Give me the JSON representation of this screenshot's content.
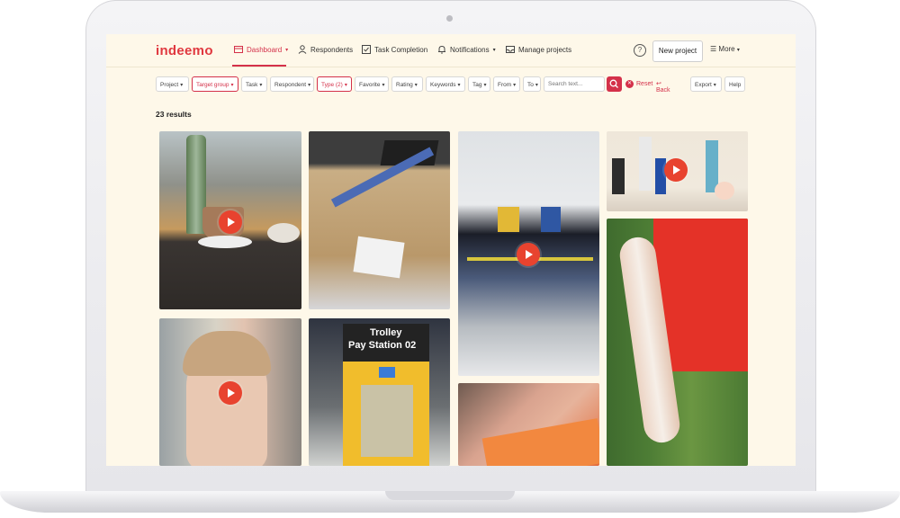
{
  "app": {
    "logo": "indeemo"
  },
  "nav": {
    "items": [
      {
        "label": "Dashboard",
        "icon": "dashboard-icon",
        "active": true
      },
      {
        "label": "Respondents",
        "icon": "user-icon"
      },
      {
        "label": "Task Completion",
        "icon": "checkbox-icon"
      },
      {
        "label": "Notifications",
        "icon": "bell-icon"
      },
      {
        "label": "Manage projects",
        "icon": "inbox-icon"
      }
    ],
    "help_icon": "question-circle-icon",
    "new_project_label": "New project",
    "more_label": "More"
  },
  "filters": {
    "chips": [
      {
        "label": "Project",
        "selected": false
      },
      {
        "label": "Target group",
        "selected": true
      },
      {
        "label": "Task",
        "selected": false
      },
      {
        "label": "Respondent",
        "selected": false
      },
      {
        "label": "Type (2)",
        "selected": true
      },
      {
        "label": "Favorite",
        "selected": false
      },
      {
        "label": "Rating",
        "selected": false
      },
      {
        "label": "Keywords",
        "selected": false
      },
      {
        "label": "Tag",
        "selected": false
      },
      {
        "label": "From",
        "selected": false
      },
      {
        "label": "To",
        "selected": false
      }
    ],
    "search_placeholder": "Search text...",
    "reset_label": "Reset",
    "back_label": "Back",
    "export_label": "Export",
    "help_label": "Help"
  },
  "results_label": "23 results",
  "media": [
    {
      "id": "cafe-latte",
      "has_play": true
    },
    {
      "id": "cardboard-box",
      "has_play": false
    },
    {
      "id": "airport-queue",
      "has_play": true
    },
    {
      "id": "toiletries-shelf",
      "has_play": true
    },
    {
      "id": "selfie-woman",
      "has_play": true
    },
    {
      "id": "trolley-pay-station",
      "has_play": false,
      "sign_line1": "Trolley",
      "sign_line2": "Pay Station 02"
    },
    {
      "id": "hand-ticket",
      "has_play": false
    },
    {
      "id": "sunscreen-arm",
      "has_play": false
    }
  ],
  "colors": {
    "accent": "#d4314a",
    "play": "#e8432f",
    "screen_bg": "#fef8e9"
  }
}
